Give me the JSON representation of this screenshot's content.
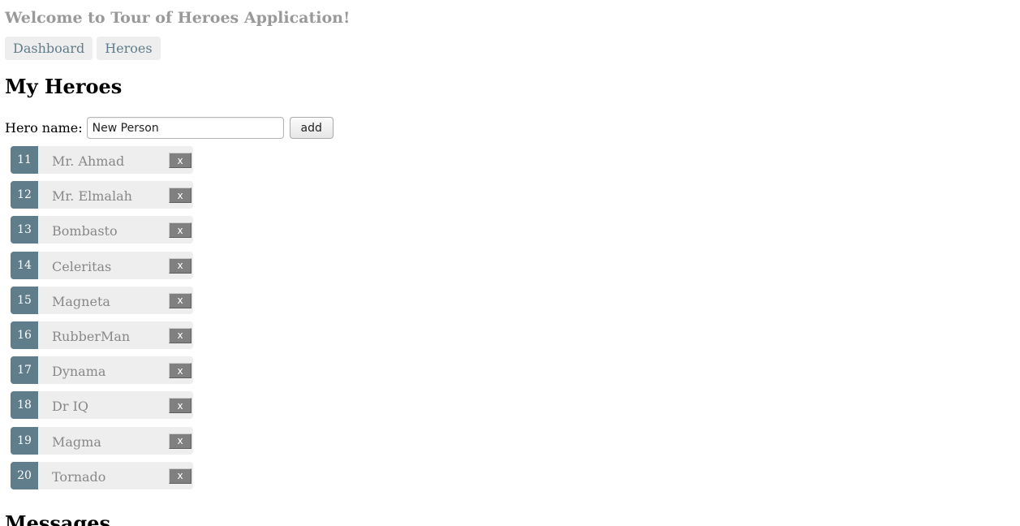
{
  "header": {
    "title": "Welcome to Tour of Heroes Application!"
  },
  "nav": {
    "items": [
      {
        "label": "Dashboard"
      },
      {
        "label": "Heroes"
      }
    ]
  },
  "main": {
    "heading": "My Heroes",
    "add_form": {
      "label": "Hero name:",
      "input_value": "New Person",
      "button_label": "add"
    },
    "delete_label": "x",
    "heroes": [
      {
        "id": "11",
        "name": "Mr. Ahmad"
      },
      {
        "id": "12",
        "name": "Mr. Elmalah"
      },
      {
        "id": "13",
        "name": "Bombasto"
      },
      {
        "id": "14",
        "name": "Celeritas"
      },
      {
        "id": "15",
        "name": "Magneta"
      },
      {
        "id": "16",
        "name": "RubberMan"
      },
      {
        "id": "17",
        "name": "Dynama"
      },
      {
        "id": "18",
        "name": "Dr IQ"
      },
      {
        "id": "19",
        "name": "Magma"
      },
      {
        "id": "20",
        "name": "Tornado"
      }
    ]
  },
  "messages": {
    "heading": "Messages"
  },
  "colors": {
    "accent": "#607d8b",
    "item_background": "#eeeeee",
    "title_gray": "#999999"
  }
}
